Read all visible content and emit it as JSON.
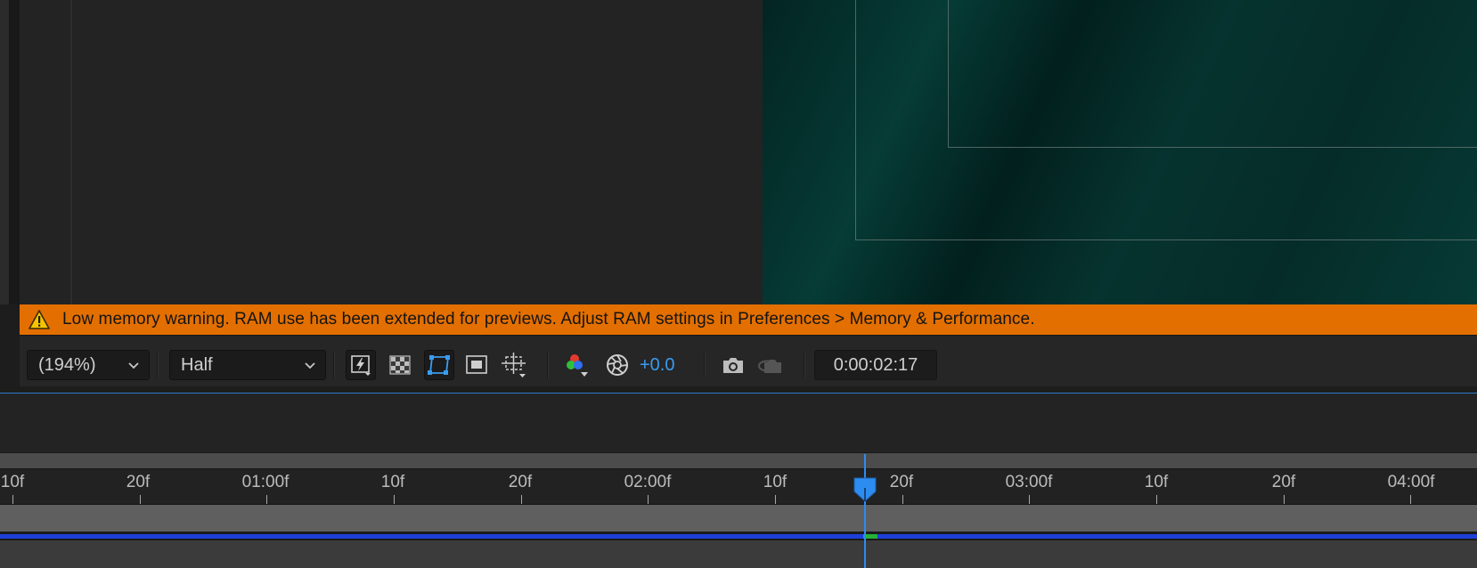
{
  "warning": {
    "text": "Low memory warning. RAM use has been extended for previews. Adjust RAM settings in Preferences > Memory & Performance.",
    "icon": "warning-triangle-icon"
  },
  "toolbar": {
    "magnification": "(194%)",
    "resolution": "Half",
    "exposure": "+0.0",
    "timecode": "0:00:02:17"
  },
  "ruler": {
    "labels": [
      "10f",
      "20f",
      "01:00f",
      "10f",
      "20f",
      "02:00f",
      "10f",
      "20f",
      "03:00f",
      "10f",
      "20f",
      "04:00f"
    ]
  },
  "colors": {
    "warning_bg": "#e36f00",
    "accent_blue": "#2d8cf0",
    "cache_blue": "#1e3fd8",
    "cache_green": "#24b23b"
  }
}
